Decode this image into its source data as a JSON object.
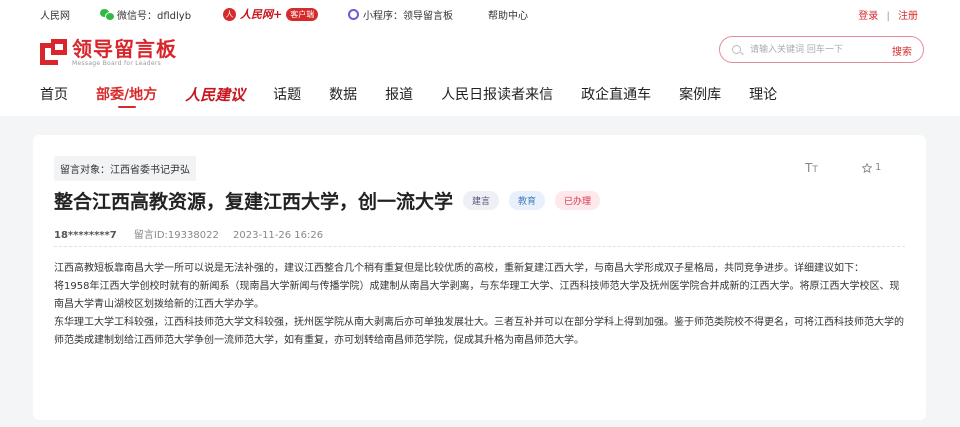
{
  "topbar": {
    "rmw": "人民网",
    "wechat": "微信号：dfldlyb",
    "rmw_plus_circle": "人",
    "rmw_plus": "人民网+",
    "client_badge": "客户端",
    "mini_program": "小程序：领导留言板",
    "help": "帮助中心",
    "login": "登录",
    "separator": "|",
    "register": "注册"
  },
  "header": {
    "logo_cn": "领导留言板",
    "logo_en": "Message Board for Leaders",
    "search_placeholder": "请输入关键词 回车一下",
    "search_button": "搜索"
  },
  "nav": {
    "items": [
      {
        "label": "首页"
      },
      {
        "label": "部委/地方"
      },
      {
        "label": "人民建议"
      },
      {
        "label": "话题"
      },
      {
        "label": "数据"
      },
      {
        "label": "报道"
      },
      {
        "label": "人民日报读者来信"
      },
      {
        "label": "政企直通车"
      },
      {
        "label": "案例库"
      },
      {
        "label": "理论"
      }
    ]
  },
  "message": {
    "target": "留言对象：江西省委书记尹弘",
    "font_icon_big": "T",
    "font_icon_small": "T",
    "star_count": "1",
    "title": "整合江西高教资源，复建江西大学，创一流大学",
    "tags": [
      "建言",
      "教育",
      "已办理"
    ],
    "author": "18********7",
    "message_id": "留言ID:19338022",
    "datetime": "2023-11-26 16:26",
    "paragraphs": [
      "江西高教短板靠南昌大学一所可以说是无法补强的，建议江西整合几个稍有重复但是比较优质的高校，重新复建江西大学，与南昌大学形成双子星格局，共同竞争进步。详细建议如下：",
      "将1958年江西大学创校时就有的新闻系（现南昌大学新闻与传播学院）成建制从南昌大学剥离，与东华理工大学、江西科技师范大学及抚州医学院合并成新的江西大学。将原江西大学校区、现南昌大学青山湖校区划拨给新的江西大学办学。",
      "东华理工大学工科较强，江西科技师范大学文科较强，抚州医学院从南大剥离后亦可单独发展壮大。三者互补并可以在部分学科上得到加强。鉴于师范类院校不得更名，可将江西科技师范大学的师范类成建制划给江西师范大学争创一流师范大学，如有重复，亦可划转给南昌师范学院，促成其升格为南昌师范大学。"
    ]
  },
  "colors": {
    "brand_red": "#d62b2b",
    "page_bg": "#f4f5f7",
    "card_bg": "#ffffff"
  }
}
